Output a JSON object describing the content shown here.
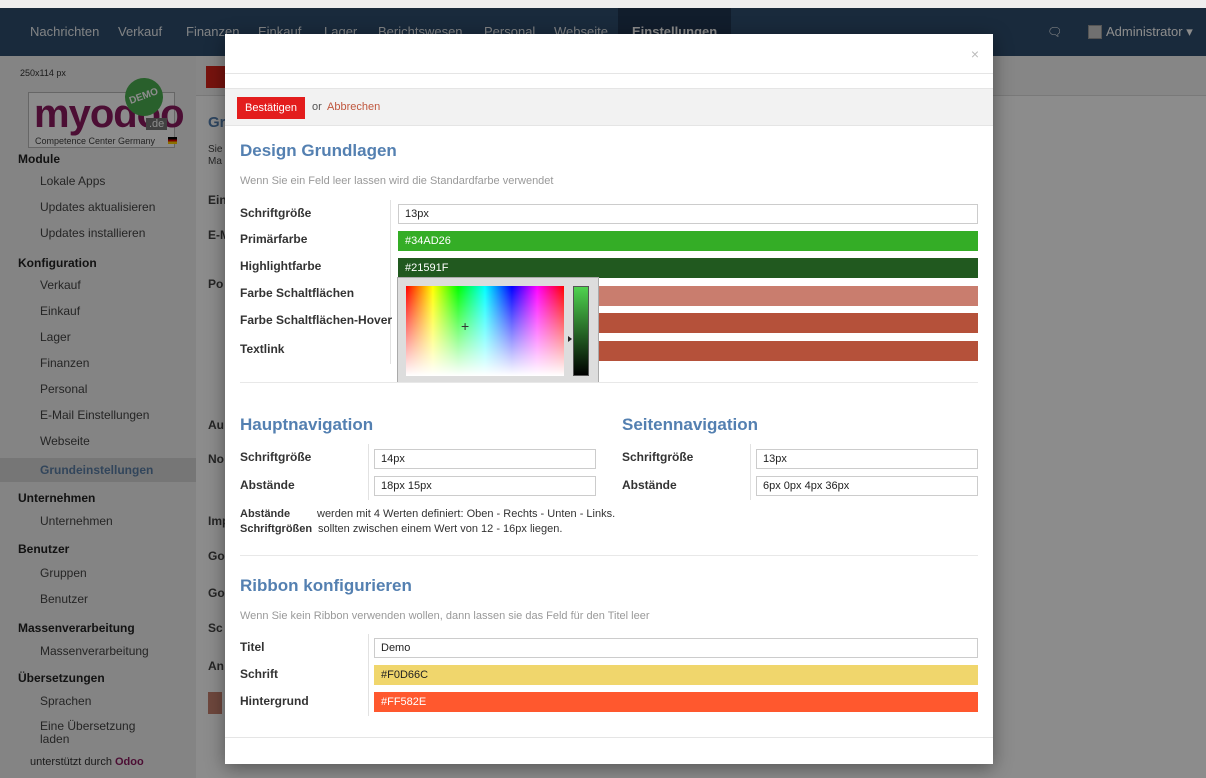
{
  "topnav": {
    "items": [
      "Nachrichten",
      "Verkauf",
      "Finanzen",
      "Einkauf",
      "Lager",
      "Berichtswesen",
      "Personal",
      "Webseite",
      "Einstellungen"
    ],
    "active": "Einstellungen",
    "user": "Administrator ▾"
  },
  "sidebar": {
    "logo": {
      "size_label": "250x114 px",
      "text": "myodoo",
      "tld": ".de",
      "tagline": "Competence Center Germany",
      "badge": "DEMO"
    },
    "groups": [
      {
        "title": "Module",
        "items": [
          "Lokale Apps",
          "Updates aktualisieren",
          "Updates installieren"
        ]
      },
      {
        "title": "Konfiguration",
        "items": [
          "Verkauf",
          "Einkauf",
          "Lager",
          "Finanzen",
          "Personal",
          "E-Mail Einstellungen",
          "Webseite",
          "Grundeinstellungen"
        ]
      },
      {
        "title": "Unternehmen",
        "items": [
          "Unternehmen"
        ]
      },
      {
        "title": "Benutzer",
        "items": [
          "Gruppen",
          "Benutzer"
        ]
      },
      {
        "title": "Massenverarbeitung",
        "items": [
          "Massenverarbeitung"
        ]
      },
      {
        "title": "Übersetzungen",
        "items": [
          "Sprachen",
          "Eine Übersetzung laden"
        ]
      }
    ],
    "active_item": "Grundeinstellungen",
    "footer_prefix": "unterstützt durch",
    "footer_brand": "Odoo"
  },
  "background": {
    "labels": [
      "Gr",
      "Sie",
      "Ma",
      "Ein",
      "E-M",
      "Po",
      "Au",
      "No",
      "Imp",
      "Go",
      "Go",
      "Sc",
      "An"
    ]
  },
  "modal": {
    "close": "×",
    "confirm": "Bestätigen",
    "or": "or",
    "cancel": "Abbrechen",
    "design": {
      "title": "Design Grundlagen",
      "hint": "Wenn Sie ein Feld leer lassen wird die Standardfarbe verwendet",
      "fields": [
        {
          "label": "Schriftgröße",
          "value": "13px",
          "bg": "#ffffff"
        },
        {
          "label": "Primärfarbe",
          "value": "#34AD26",
          "bg": "#34AD26"
        },
        {
          "label": "Highlightfarbe",
          "value": "#21591F",
          "bg": "#21591F"
        },
        {
          "label": "Farbe Schaltflächen",
          "value": "",
          "bg": "#C97D6E"
        },
        {
          "label": "Farbe Schaltflächen-Hover",
          "value": "",
          "bg": "#B5513A"
        },
        {
          "label": "Textlink",
          "value": "",
          "bg": "#B5513A"
        }
      ]
    },
    "mainnav": {
      "title": "Hauptnavigation",
      "font_label": "Schriftgröße",
      "font_value": "14px",
      "spacing_label": "Abstände",
      "spacing_value": "18px 15px"
    },
    "sidenav": {
      "title": "Seitennavigation",
      "font_label": "Schriftgröße",
      "font_value": "13px",
      "spacing_label": "Abstände",
      "spacing_value": "6px 0px 4px 36px"
    },
    "notes": {
      "spacing_term": "Abstände",
      "spacing_text": "werden mit 4 Werten definiert: Oben - Rechts - Unten - Links.",
      "font_term": "Schriftgrößen",
      "font_text": "sollten zwischen einem Wert von 12 - 16px liegen."
    },
    "ribbon": {
      "title": "Ribbon konfigurieren",
      "hint": "Wenn Sie kein Ribbon verwenden wollen, dann lassen sie das Feld für den Titel leer",
      "fields": [
        {
          "label": "Titel",
          "value": "Demo",
          "bg": "#ffffff"
        },
        {
          "label": "Schrift",
          "value": "#F0D66C",
          "bg": "#F0D66C"
        },
        {
          "label": "Hintergrund",
          "value": "#FF582E",
          "bg": "#FF582E"
        }
      ]
    }
  }
}
